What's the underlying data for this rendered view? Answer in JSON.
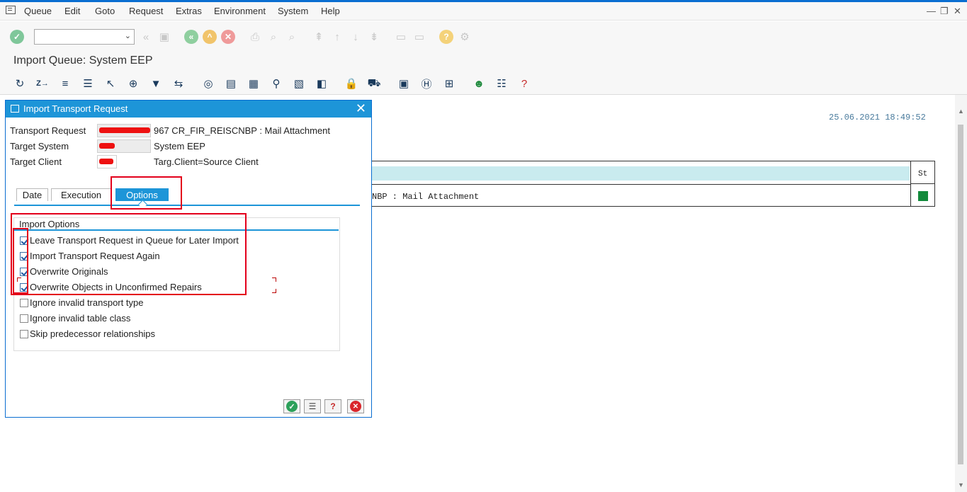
{
  "menubar": {
    "items": [
      "Queue",
      "Edit",
      "Goto",
      "Request",
      "Extras",
      "Environment",
      "System",
      "Help"
    ],
    "window_controls": [
      "—",
      "❐",
      "✕"
    ]
  },
  "command_field": {
    "value": ""
  },
  "page": {
    "title": "Import Queue: System EEP"
  },
  "background": {
    "datetime": "25.06.2021 18:49:52",
    "table_status_header": "St",
    "table_row_text": "NBP : Mail Attachment",
    "status_color": "#128a3b"
  },
  "dialog": {
    "title": "Import Transport Request",
    "fields": [
      {
        "label": "Transport Request",
        "value": "967 CR_FIR_REISCNBP : Mail Attachment"
      },
      {
        "label": "Target System",
        "value": "System EEP"
      },
      {
        "label": "Target Client",
        "value": "Targ.Client=Source Client"
      }
    ],
    "tabs": [
      "Date",
      "Execution",
      "Options"
    ],
    "active_tab": "Options",
    "import_options": {
      "title": "Import Options",
      "items": [
        {
          "label": "Leave Transport Request in Queue for Later Import",
          "checked": true
        },
        {
          "label": "Import Transport Request Again",
          "checked": true
        },
        {
          "label": "Overwrite Originals",
          "checked": true
        },
        {
          "label": "Overwrite Objects in Unconfirmed Repairs",
          "checked": true
        },
        {
          "label": "Ignore invalid transport type",
          "checked": false
        },
        {
          "label": "Ignore invalid table class",
          "checked": false
        },
        {
          "label": "Skip predecessor relationships",
          "checked": false
        }
      ]
    },
    "buttons": [
      "continue-icon",
      "options-icon",
      "help-icon",
      "cancel-icon"
    ]
  },
  "colors": {
    "accent": "#1d95d8",
    "highlight": "#e3001b",
    "ok": "#2ca05a",
    "cancel": "#d9262c"
  }
}
